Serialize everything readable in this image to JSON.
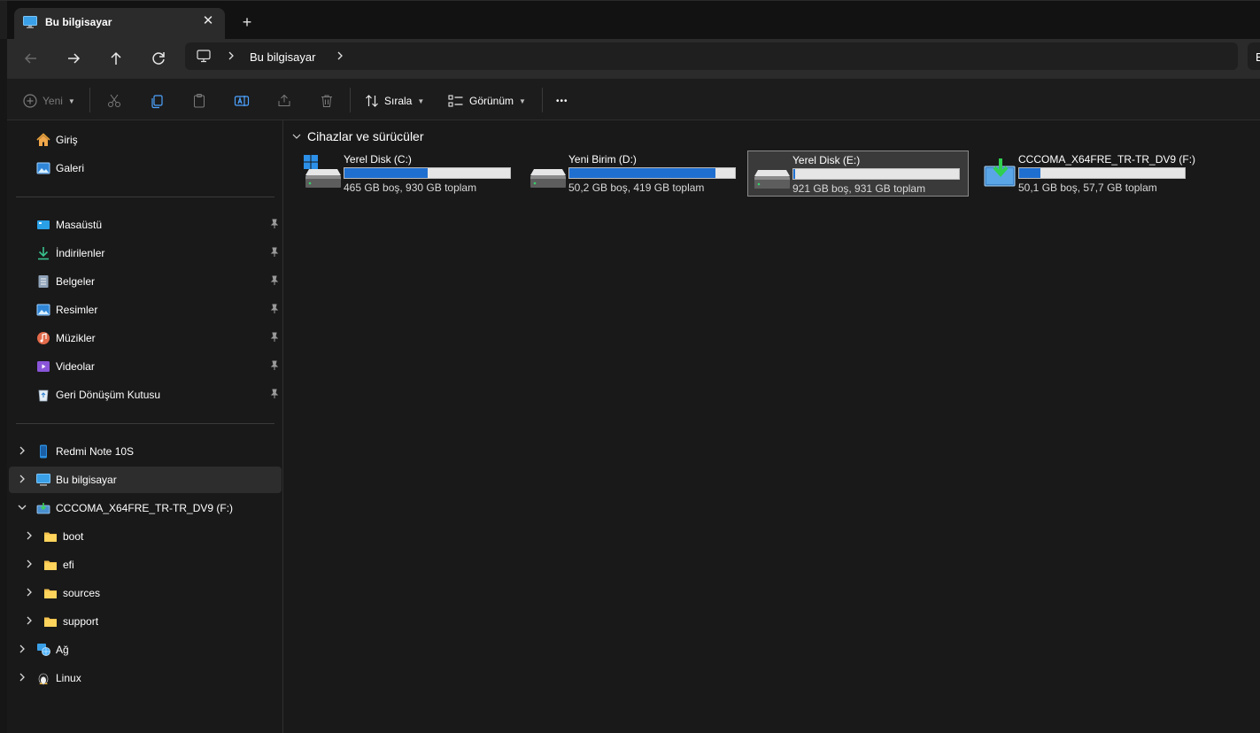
{
  "window": {
    "tab_title": "Bu bilgisayar",
    "close_label": "✕",
    "new_tab_label": "+"
  },
  "nav": {
    "breadcrumb": "Bu bilgisayar",
    "search_text": "B"
  },
  "commands": {
    "new": "Yeni",
    "sort": "Sırala",
    "view": "Görünüm",
    "more": "•••"
  },
  "sidebar": {
    "quick": [
      {
        "label": "Giriş",
        "icon": "home-icon"
      },
      {
        "label": "Galeri",
        "icon": "gallery-icon"
      }
    ],
    "pinned": [
      {
        "label": "Masaüstü",
        "icon": "desktop-icon"
      },
      {
        "label": "İndirilenler",
        "icon": "downloads-icon"
      },
      {
        "label": "Belgeler",
        "icon": "documents-icon"
      },
      {
        "label": "Resimler",
        "icon": "pictures-icon"
      },
      {
        "label": "Müzikler",
        "icon": "music-icon"
      },
      {
        "label": "Videolar",
        "icon": "videos-icon"
      },
      {
        "label": "Geri Dönüşüm Kutusu",
        "icon": "recycle-bin-icon"
      }
    ],
    "tree": [
      {
        "label": "Redmi Note 10S",
        "icon": "phone-icon"
      },
      {
        "label": "Bu bilgisayar",
        "icon": "this-pc-icon"
      },
      {
        "label": "CCCOMA_X64FRE_TR-TR_DV9 (F:)",
        "icon": "dvd-drive-icon"
      },
      {
        "label": "boot",
        "icon": "folder-icon"
      },
      {
        "label": "efi",
        "icon": "folder-icon"
      },
      {
        "label": "sources",
        "icon": "folder-icon"
      },
      {
        "label": "support",
        "icon": "folder-icon"
      },
      {
        "label": "Ağ",
        "icon": "network-icon"
      },
      {
        "label": "Linux",
        "icon": "linux-icon"
      }
    ]
  },
  "content": {
    "group_title": "Cihazlar ve sürücüler",
    "drives": [
      {
        "name": "Yerel Disk (C:)",
        "info": "465 GB boş, 930 GB toplam",
        "used_fraction": 0.5,
        "icon": "windows-drive-icon"
      },
      {
        "name": "Yeni Birim (D:)",
        "info": "50,2 GB boş, 419 GB toplam",
        "used_fraction": 0.88,
        "icon": "hard-drive-icon"
      },
      {
        "name": "Yerel Disk (E:)",
        "info": "921 GB boş, 931 GB toplam",
        "used_fraction": 0.01,
        "icon": "hard-drive-icon"
      },
      {
        "name": "CCCOMA_X64FRE_TR-TR_DV9 (F:)",
        "info": "50,1 GB boş, 57,7 GB toplam",
        "used_fraction": 0.13,
        "icon": "dvd-drive-icon"
      }
    ]
  },
  "colors": {
    "accent": "#1f6fd1",
    "background": "#191919",
    "chrome": "#2b2b2b"
  }
}
